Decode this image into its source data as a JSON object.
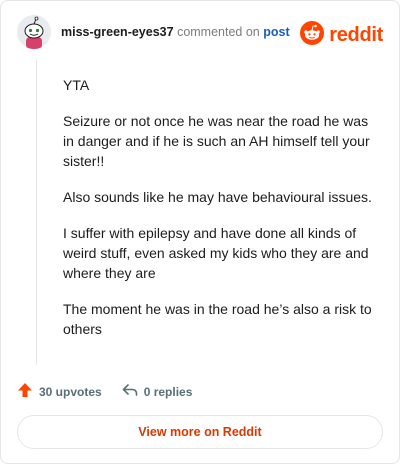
{
  "comment": {
    "username": "miss-green-eyes37",
    "action_text": "commented on",
    "post_link": "post",
    "paragraphs": [
      "YTA",
      "Seizure or not once he was near the road he was in danger and if he is such an AH himself tell your sister!!",
      "Also sounds like he may have behavioural issues.",
      "I suffer with epilepsy and have done all kinds of weird stuff, even asked my kids who they are and where they are",
      "The moment he was in the road he’s also a risk to others"
    ]
  },
  "brand": {
    "wordmark": "reddit",
    "color": "#ff4500"
  },
  "actions": {
    "upvotes": "30 upvotes",
    "replies": "0 replies"
  },
  "footer": {
    "view_more": "View more on Reddit"
  },
  "icons": {
    "avatar": "snoo-avatar-icon",
    "logo": "reddit-logo-icon",
    "upvote": "upvote-arrow-icon",
    "reply": "reply-arrow-icon"
  }
}
